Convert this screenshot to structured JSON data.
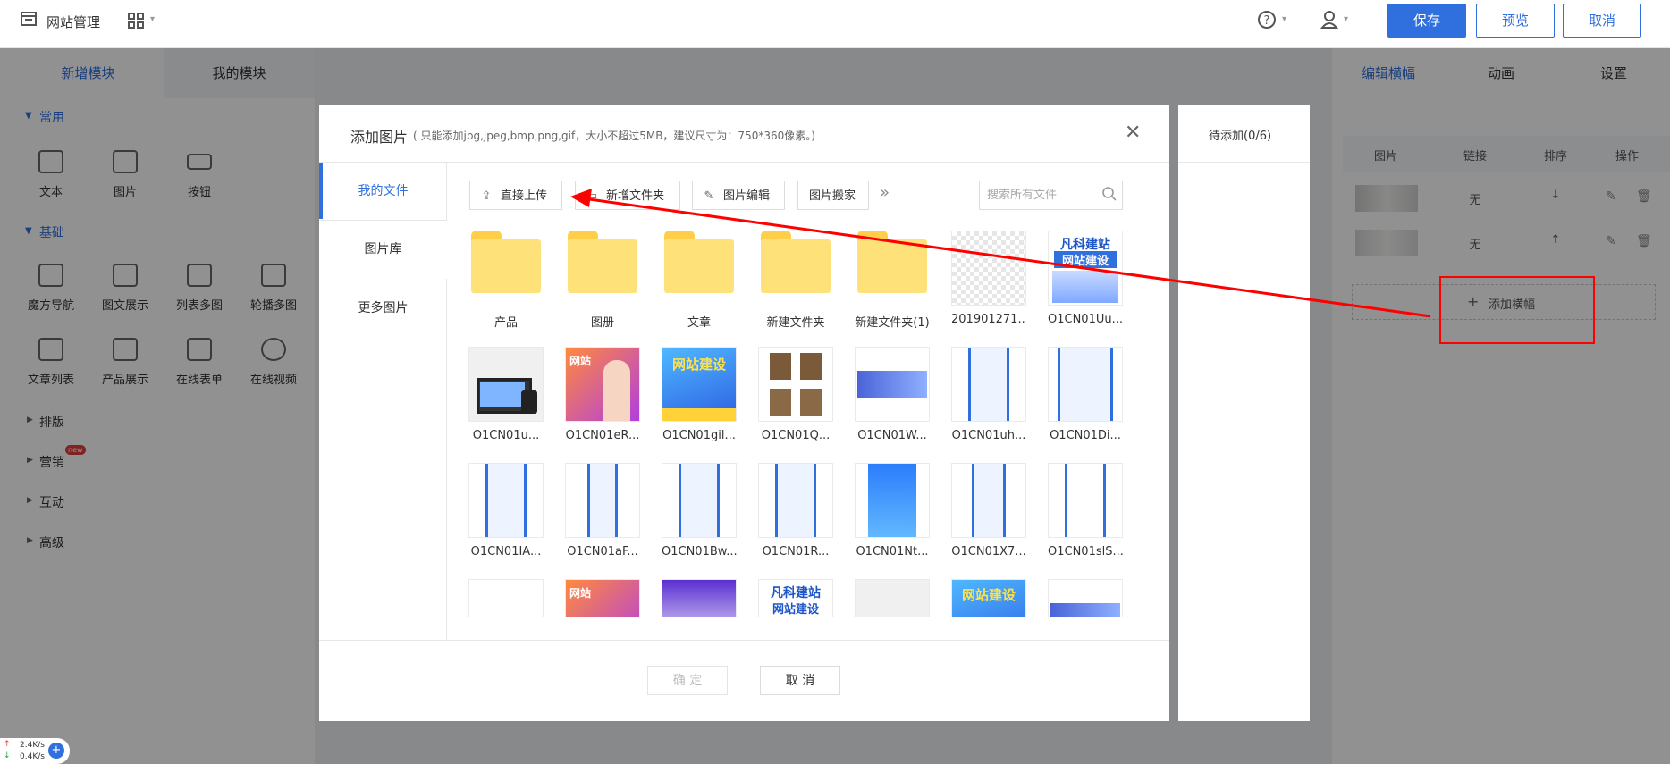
{
  "topbar": {
    "title": "网站管理",
    "title_icon": "window-icon",
    "apps_icon": "grid-icon",
    "help_icon": "question-circle-icon",
    "user_icon": "user-icon",
    "save": "保存",
    "preview": "预览",
    "cancel": "取消"
  },
  "left": {
    "tabs": [
      "新增模块",
      "我的模块"
    ],
    "common_title": "常用",
    "common_items": [
      "文本",
      "图片",
      "按钮"
    ],
    "basic_title": "基础",
    "basic_items": [
      "魔方导航",
      "图文展示",
      "列表多图",
      "轮播多图",
      "文章列表",
      "产品展示",
      "在线表单",
      "在线视频"
    ],
    "groups": [
      "排版",
      "营销",
      "互动",
      "高级"
    ],
    "new_badge": "new"
  },
  "right": {
    "tabs": [
      "编辑横幅",
      "动画",
      "设置"
    ],
    "headers": [
      "图片",
      "链接",
      "排序",
      "操作"
    ],
    "rows": [
      {
        "link": "无",
        "sort": "↓"
      },
      {
        "link": "无",
        "sort": "↑"
      }
    ],
    "add_banner": "添加横幅"
  },
  "dialog": {
    "title": "添加图片",
    "subtitle": "( 只能添加jpg,jpeg,bmp,png,gif，大小不超过5MB，建议尺寸为：750*360像素。)",
    "nav": [
      "我的文件",
      "图片库",
      "更多图片"
    ],
    "toolbar": [
      "直接上传",
      "新增文件夹",
      "图片编辑",
      "图片搬家"
    ],
    "more_icon": "double-chevron-right-icon",
    "search_placeholder": "搜索所有文件",
    "confirm": "确 定",
    "cancel": "取 消",
    "pending": "待添加(0/6)",
    "row1": [
      "产品",
      "图册",
      "文章",
      "新建文件夹",
      "新建文件夹(1)",
      "201901271...",
      "O1CN01Uu..."
    ],
    "row2": [
      "O1CN01u...",
      "O1CN01eR...",
      "O1CN01gil...",
      "O1CN01Q...",
      "O1CN01W...",
      "O1CN01uh...",
      "O1CN01Di..."
    ],
    "row3": [
      "O1CN01IA...",
      "O1CN01aF...",
      "O1CN01Bw...",
      "O1CN01R...",
      "O1CN01Nt...",
      "O1CN01X7...",
      "O1CN01slS..."
    ],
    "thumb_text": {
      "fanke1": "凡科建站",
      "fanke2": "网站建设",
      "wangzhan_jianshe": "网站建设",
      "wangzhan": "网站"
    }
  },
  "netspeed": {
    "up": "2.4K/s",
    "down": "0.4K/s"
  },
  "colors": {
    "accent": "#2f6fde",
    "annotation": "#ff0000"
  }
}
